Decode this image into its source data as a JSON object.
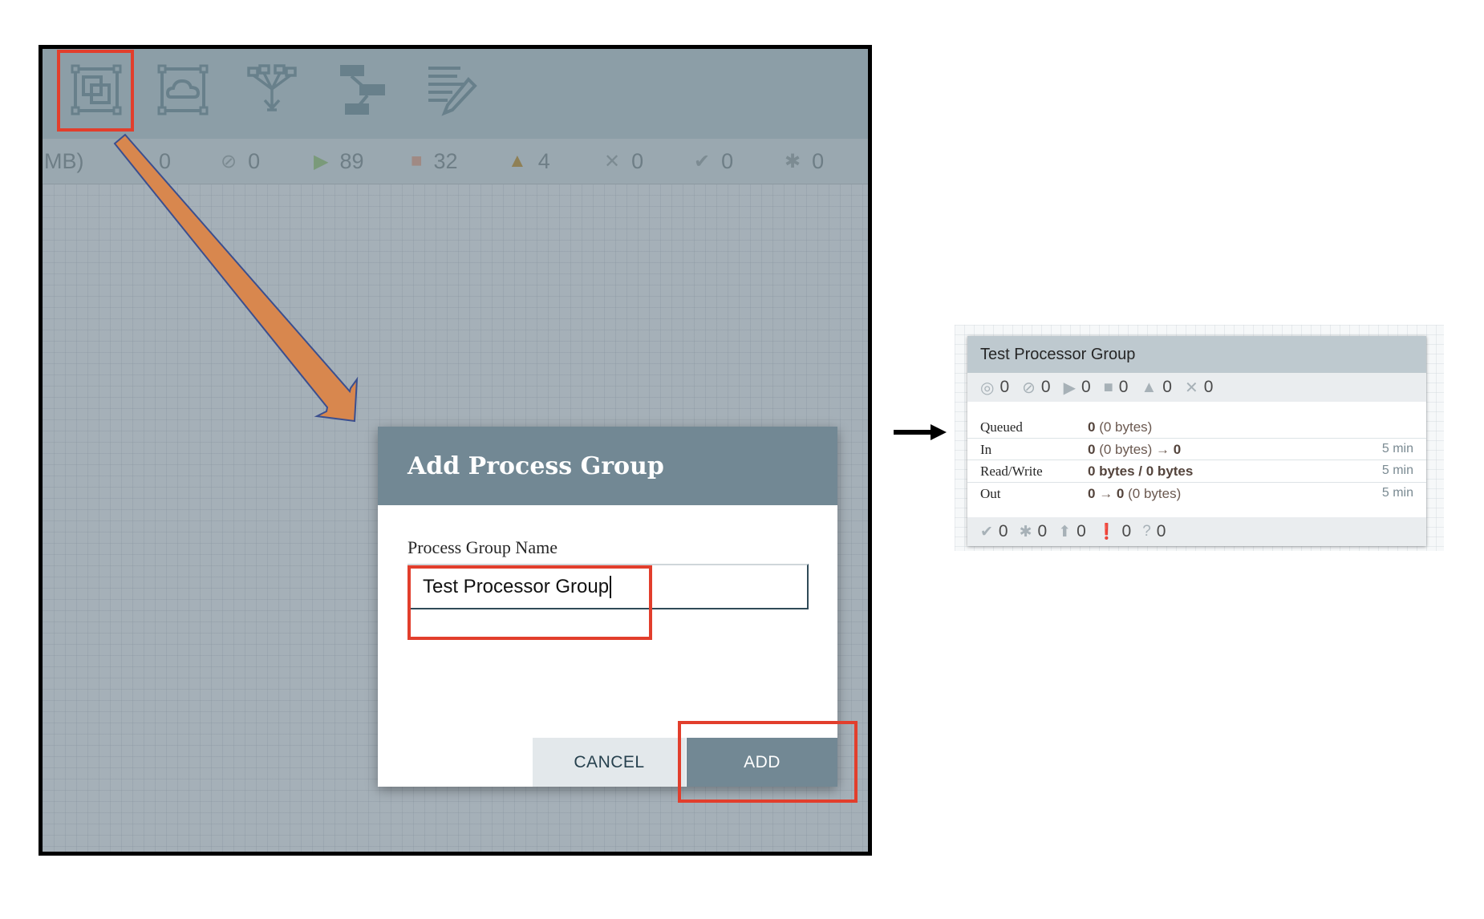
{
  "canvas": {
    "toolbar": {
      "tools": [
        {
          "icon": "process-group-icon"
        },
        {
          "icon": "remote-process-group-icon"
        },
        {
          "icon": "funnel-icon"
        },
        {
          "icon": "template-icon"
        },
        {
          "icon": "label-icon"
        }
      ]
    },
    "status": {
      "prefix": "MB)",
      "items": [
        {
          "icon": "transmitting-icon",
          "value": "0"
        },
        {
          "icon": "not-transmitting-icon",
          "value": "0"
        },
        {
          "icon": "running-icon",
          "value": "89"
        },
        {
          "icon": "stopped-icon",
          "value": "32"
        },
        {
          "icon": "invalid-icon",
          "value": "4"
        },
        {
          "icon": "disabled-icon",
          "value": "0"
        },
        {
          "icon": "up-to-date-icon",
          "value": "0"
        },
        {
          "icon": "locally-modified-icon",
          "value": "0"
        }
      ]
    }
  },
  "dialog": {
    "title": "Add Process Group",
    "field_label": "Process Group Name",
    "field_value": "Test Processor Group",
    "cancel_label": "CANCEL",
    "add_label": "ADD"
  },
  "process_group": {
    "name": "Test Processor Group",
    "stats": [
      {
        "icon": "transmitting-icon",
        "value": "0"
      },
      {
        "icon": "not-transmitting-icon",
        "value": "0"
      },
      {
        "icon": "running-icon",
        "value": "0"
      },
      {
        "icon": "stopped-icon",
        "value": "0"
      },
      {
        "icon": "invalid-icon",
        "value": "0"
      },
      {
        "icon": "disabled-icon",
        "value": "0"
      }
    ],
    "rows": {
      "queued": {
        "label": "Queued",
        "count": "0",
        "detail": " (0 bytes)"
      },
      "in": {
        "label": "In",
        "count": "0",
        "detail": " (0 bytes) → ",
        "count2": "0",
        "time": "5 min"
      },
      "read_write": {
        "label": "Read/Write",
        "value": "0 bytes / 0 bytes",
        "time": "5 min"
      },
      "out": {
        "label": "Out",
        "count": "0",
        "arrow": " → ",
        "count2": "0",
        "detail": " (0 bytes)",
        "time": "5 min"
      }
    },
    "footer": [
      {
        "icon": "up-to-date-icon",
        "value": "0"
      },
      {
        "icon": "locally-modified-icon",
        "value": "0"
      },
      {
        "icon": "stale-icon",
        "value": "0"
      },
      {
        "icon": "sync-failure-icon",
        "value": "0"
      },
      {
        "icon": "unknown-icon",
        "value": "0"
      }
    ]
  },
  "colors": {
    "highlight": "#e23e2c",
    "annotation_arrow": "#d8874e",
    "dialog_header": "#728894"
  }
}
